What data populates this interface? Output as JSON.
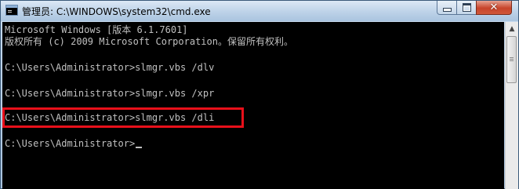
{
  "window": {
    "title": "管理员: C:\\WINDOWS\\system32\\cmd.exe",
    "icon": "console-app-icon",
    "controls": {
      "minimize": "minimize-icon",
      "maximize": "maximize-icon",
      "close": "close-icon"
    }
  },
  "console": {
    "lines": [
      "Microsoft Windows [版本 6.1.7601]",
      "版权所有 (c) 2009 Microsoft Corporation。保留所有权利。",
      "",
      "C:\\Users\\Administrator>slmgr.vbs /dlv",
      "",
      "C:\\Users\\Administrator>slmgr.vbs /xpr",
      "",
      "C:\\Users\\Administrator>slmgr.vbs /dli",
      "",
      "C:\\Users\\Administrator>"
    ],
    "highlighted_line": 7,
    "highlight_color": "#e8101a",
    "text_color": "#c0c0c0",
    "background_color": "#000000"
  },
  "colors": {
    "close_button": "#c7442b"
  }
}
